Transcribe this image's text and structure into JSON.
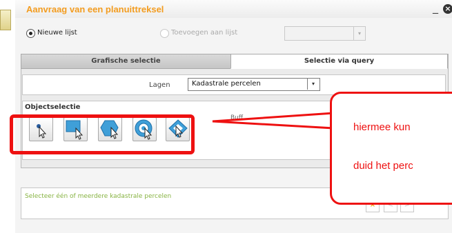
{
  "window": {
    "title": "Aanvraag van een planuittreksel",
    "minimize_glyph": "_",
    "close_glyph": "×"
  },
  "radios": {
    "new_label": "Nieuwe lijst",
    "new_checked": true,
    "add_label": "Toevoegen aan lijst",
    "add_disabled": true
  },
  "add_select": {
    "value": "",
    "arrow_glyph": "▾"
  },
  "tabs": [
    {
      "label": "Grafische selectie",
      "active": false
    },
    {
      "label": "Selectie via query",
      "active": true
    }
  ],
  "lagen": {
    "label": "Lagen",
    "value": "Kadastrale percelen",
    "arrow_glyph": "▾"
  },
  "objectselectie": {
    "title": "Objectselectie",
    "buffer_label": "Buff",
    "tools": [
      {
        "name": "point-select-icon"
      },
      {
        "name": "rectangle-select-icon"
      },
      {
        "name": "polygon-select-icon"
      },
      {
        "name": "circle-select-icon"
      },
      {
        "name": "diamond-select-icon"
      }
    ]
  },
  "callout": {
    "line1": "hiermee kun",
    "line2": "duid het perc",
    "color": "#ee1111"
  },
  "status": {
    "text": "Selecteer één of meerdere kadastrale percelen",
    "clear_glyph": "×",
    "prev_glyph": "<",
    "next_glyph": ">"
  },
  "colors": {
    "title": "#f39c1f",
    "status_text": "#87b342",
    "highlight": "#ee1111"
  }
}
